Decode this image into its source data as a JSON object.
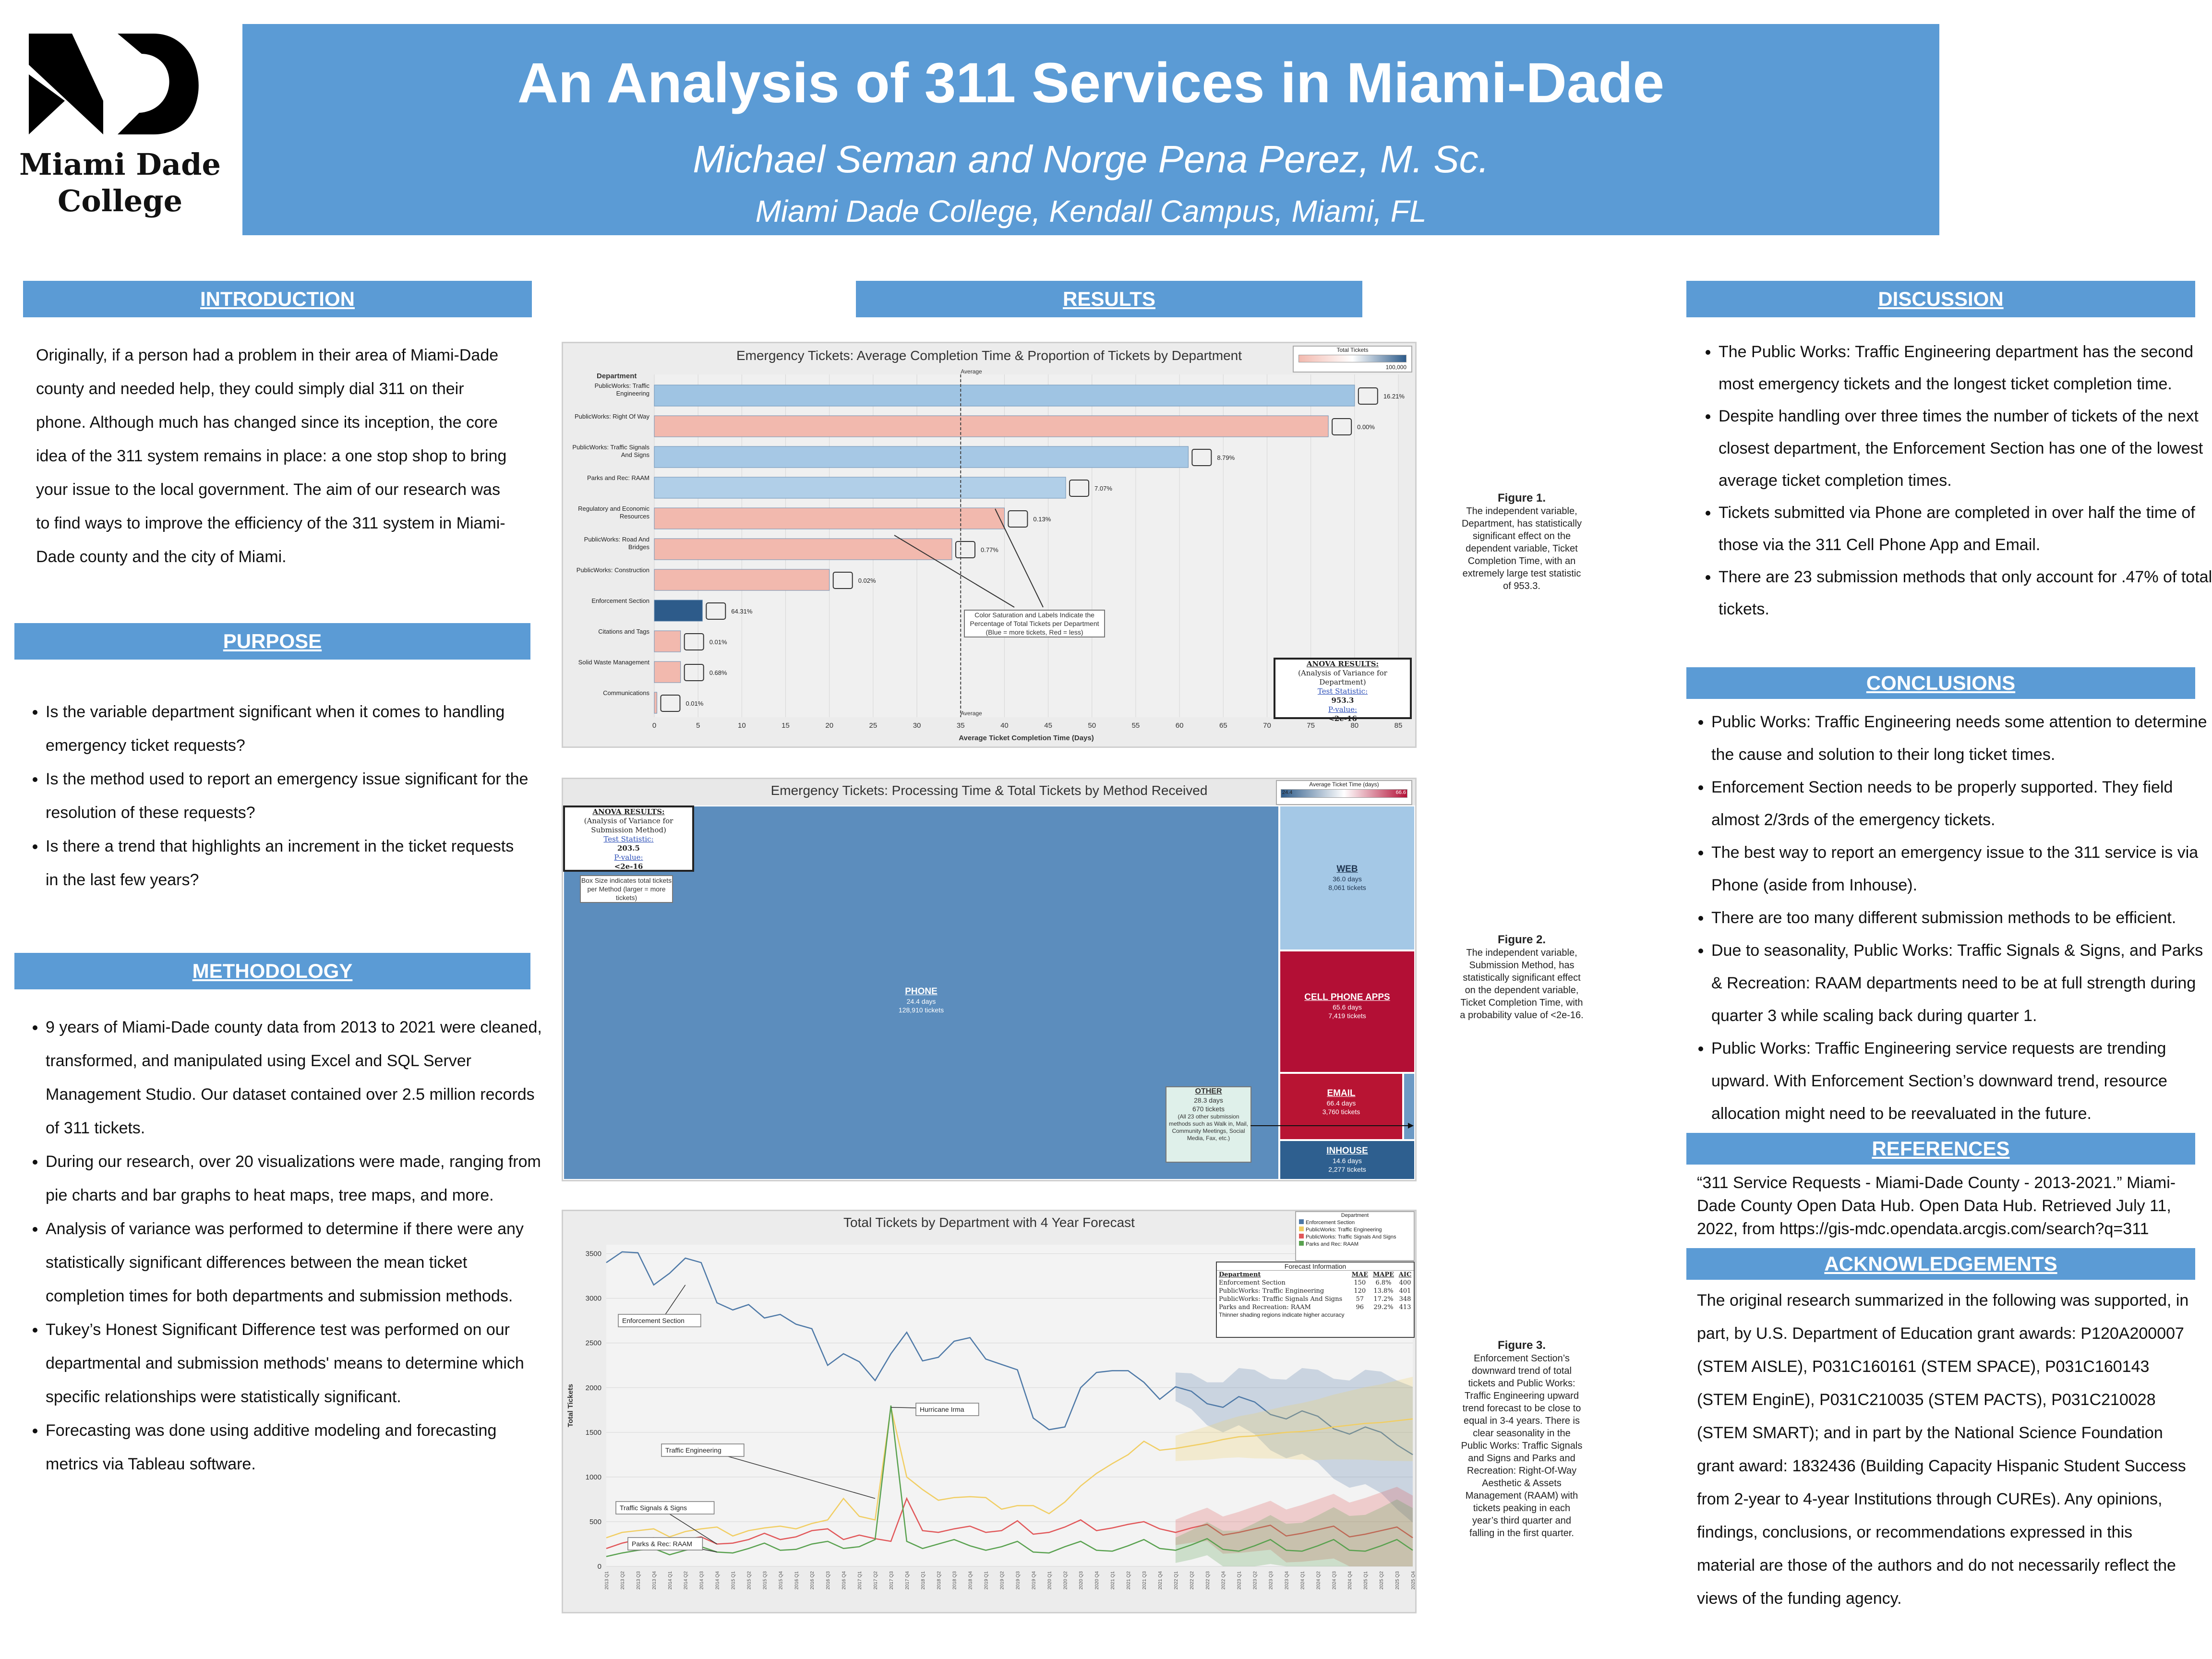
{
  "logo": {
    "line1": "Miami Dade",
    "line2": "College"
  },
  "title": "An Analysis of 311 Services in Miami-Dade",
  "authors": "Michael Seman and Norge Pena Perez, M. Sc.",
  "institution": "Miami Dade College, Kendall Campus, Miami, FL",
  "sections": {
    "introduction": {
      "heading": "INTRODUCTION",
      "text": "Originally, if a person had a problem in their area of Miami-Dade county and needed help, they could simply dial 311 on their phone.  Although much has changed since its inception, the core idea of the 311 system remains in place: a one stop shop to bring your issue to the local government.  The aim of our research was to find ways to improve the efficiency of the 311 system in Miami-Dade county and the city of Miami."
    },
    "purpose": {
      "heading": "PURPOSE",
      "items": [
        "Is the variable department significant when it comes to handling emergency ticket requests?",
        "Is the method used to report an emergency issue significant for the resolution of these requests?",
        "Is there a trend that highlights an increment in the ticket requests in the last few years?"
      ]
    },
    "methodology": {
      "heading": "METHODOLOGY",
      "items": [
        "9 years of Miami-Dade county data from 2013 to 2021 were cleaned, transformed, and manipulated using Excel and SQL Server Management Studio.  Our dataset contained over 2.5 million records of 311 tickets.",
        "During our research, over 20 visualizations were made, ranging from pie charts and bar graphs to heat maps, tree maps, and more.",
        "Analysis of variance was performed to determine if there were any statistically significant differences between the mean ticket completion times for both departments and submission methods.",
        "Tukey’s Honest Significant Difference test was performed on our departmental and submission methods' means to determine which specific relationships were statistically significant.",
        "Forecasting was done using additive modeling and forecasting metrics via Tableau software."
      ]
    },
    "results": {
      "heading": "RESULTS"
    },
    "discussion": {
      "heading": "DISCUSSION",
      "items": [
        "The Public Works: Traffic Engineering department has the second most emergency tickets and the longest ticket completion time.",
        "Despite handling over three times the number of tickets of the next closest department, the Enforcement Section has one of the lowest average ticket completion times.",
        "Tickets submitted via Phone are completed in over half the time of those via the 311 Cell Phone App and Email.",
        "There are 23 submission methods that only account for .47% of total tickets."
      ]
    },
    "conclusions": {
      "heading": "CONCLUSIONS",
      "items": [
        "Public Works: Traffic Engineering needs some attention to determine the cause and solution to their long ticket times.",
        "Enforcement Section needs to be properly supported. They field almost 2/3rds of the emergency tickets.",
        "The best way to report an emergency issue to the 311 service is via Phone (aside from Inhouse).",
        "There are too many different submission methods to be efficient.",
        "Due to seasonality, Public Works: Traffic Signals & Signs, and Parks & Recreation: RAAM departments need to be at full strength during quarter 3 while scaling back during quarter 1.",
        "Public Works: Traffic Engineering service requests are trending upward. With Enforcement Section’s downward trend, resource allocation might need to be reevaluated in the future."
      ]
    },
    "references": {
      "heading": "REFERENCES",
      "text": "“311 Service Requests - Miami-Dade County - 2013-2021.” Miami-Dade County Open Data Hub. Open Data Hub. Retrieved July 11, 2022, from https://gis-mdc.opendata.arcgis.com/search?q=311"
    },
    "acknowledgements": {
      "heading": "ACKNOWLEDGEMENTS",
      "text": "The original research summarized in the following was supported, in part, by U.S. Department of Education grant awards: P120A200007 (STEM AISLE), P031C160161 (STEM SPACE), P031C160143 (STEM EnginE), P031C210035 (STEM PACTS), P031C210028 (STEM SMART); and in part by the National Science Foundation grant award: 1832436 (Building Capacity Hispanic Student Success from 2-year to 4-year Institutions through CUREs). Any opinions, findings, conclusions, or recommendations expressed in this material are those of the authors and do not necessarily reflect the views of the funding agency."
    }
  },
  "figures": {
    "fig1": {
      "caption_label": "Figure 1.",
      "caption": "The independent variable, Department, has statistically significant effect on the dependent variable, Ticket Completion Time, with an extremely large test statistic of 953.3.",
      "note": "Color Saturation and Labels Indicate the Percentage of Total Tickets per Department (Blue = more tickets, Red = less)",
      "anova": {
        "h1": "ANOVA RESULTS:",
        "h2": "(Analysis of Variance for Department)",
        "l1": "Test Statistic:",
        "v1": "953.3",
        "l2": "P-value:",
        "v2": "<2e-16"
      },
      "legend_title": "Total Tickets",
      "legend_max": "100,000",
      "avg_label": "Average"
    },
    "fig2": {
      "title": "Emergency Tickets: Processing Time & Total Tickets by Method Received",
      "caption_label": "Figure 2.",
      "caption": "The independent variable, Submission Method, has statistically significant effect on the dependent variable, Ticket Completion Time, with a probability value of <2e-16.",
      "legend_title": "Average Ticket Time (days)",
      "legend_min": "24.4",
      "legend_max": "66.6",
      "anova": {
        "h1": "ANOVA RESULTS:",
        "h2": "(Analysis of Variance for Submission Method)",
        "l1": "Test Statistic:",
        "v1": "203.5",
        "l2": "P-value:",
        "v2": "<2e-16"
      },
      "note": "Box Size indicates total tickets per Method (larger = more tickets)",
      "boxes": {
        "phone": {
          "name": "PHONE",
          "days": "24.4 days",
          "tickets": "128,910 tickets"
        },
        "web": {
          "name": "WEB",
          "days": "36.0 days",
          "tickets": "8,061 tickets"
        },
        "cell": {
          "name": "CELL PHONE APPS",
          "days": "65.6 days",
          "tickets": "7,419 tickets"
        },
        "email": {
          "name": "EMAIL",
          "days": "66.4 days",
          "tickets": "3,760 tickets"
        },
        "inhouse": {
          "name": "INHOUSE",
          "days": "14.6 days",
          "tickets": "2,277 tickets"
        },
        "other": {
          "name": "OTHER",
          "days": "28.3 days",
          "tickets": "670 tickets",
          "desc": "(All 23 other submission methods such as Walk in, Mail, Community Meetings, Social Media, Fax, etc.)"
        }
      }
    },
    "fig3": {
      "caption_label": "Figure 3.",
      "caption": "Enforcement Section’s downward trend of total tickets and Public Works: Traffic Engineering upward trend forecast to be close to equal in 3-4 years.  There is clear seasonality in the Public Works: Traffic Signals and Signs and Parks and Recreation: Right-Of-Way Aesthetic & Assets Management (RAAM) with tickets peaking in each year’s third quarter and falling in the first quarter.",
      "forecast": {
        "title": "Forecast Information",
        "headers": [
          "Department",
          "MAE",
          "MAPE",
          "AIC"
        ],
        "rows": [
          [
            "Enforcement Section",
            "150",
            "6.8%",
            "400"
          ],
          [
            "PublicWorks: Traffic Engineering",
            "120",
            "13.8%",
            "401"
          ],
          [
            "PublicWorks: Traffic Signals And Signs",
            "57",
            "17.2%",
            "348"
          ],
          [
            "Parks and Recreation: RAAM",
            "96",
            "29.2%",
            "413"
          ]
        ],
        "note": "Thinner shading regions indicate higher accuracy"
      },
      "annotations": {
        "enf": "Enforcement Section",
        "te": "Traffic Engineering",
        "tss": "Traffic Signals & Signs",
        "raam": "Parks & Rec: RAAM",
        "irma": "Hurricane Irma"
      }
    }
  },
  "chart_data": [
    {
      "type": "bar",
      "title": "Emergency Tickets: Average Completion Time & Proportion of Tickets by Department",
      "xlabel": "Average Ticket Completion Time (Days)",
      "ylabel": "Department",
      "xlim": [
        0,
        85
      ],
      "xticks": [
        0,
        5,
        10,
        15,
        20,
        25,
        30,
        35,
        40,
        45,
        50,
        55,
        60,
        65,
        70,
        75,
        80,
        85
      ],
      "average": 35,
      "categories": [
        "PublicWorks: Traffic Engineering",
        "PublicWorks: Right Of Way",
        "PublicWorks: Traffic Signals And Signs",
        "Parks and Rec: RAAM",
        "Regulatory and Economic Resources",
        "PublicWorks: Road And Bridges",
        "PublicWorks: Construction",
        "Enforcement Section",
        "Citations and Tags",
        "Solid Waste Management",
        "Communications"
      ],
      "values": [
        80,
        77,
        61,
        47,
        40,
        34,
        20,
        5.5,
        3,
        3,
        0.3
      ],
      "pct_labels": [
        "16.21%",
        "0.00%",
        "8.79%",
        "7.07%",
        "0.13%",
        "0.77%",
        "0.02%",
        "64.31%",
        "0.01%",
        "0.68%",
        "0.01%"
      ],
      "colors": [
        "#9fc4e3",
        "#f2b9ae",
        "#a6c8e5",
        "#b1cfe8",
        "#f2b9ae",
        "#f2b9ae",
        "#f2b9ae",
        "#2d5b8a",
        "#f2b9ae",
        "#f2b9ae",
        "#f2b9ae"
      ],
      "grid": true
    },
    {
      "type": "line",
      "title": "Total Tickets by Department with 4 Year Forecast",
      "ylabel": "Total Tickets",
      "ylim": [
        0,
        3600
      ],
      "yticks": [
        0,
        500,
        1000,
        1500,
        2000,
        2500,
        3000,
        3500
      ],
      "x": [
        "2013 Q1",
        "2013 Q2",
        "2013 Q3",
        "2013 Q4",
        "2014 Q1",
        "2014 Q2",
        "2014 Q3",
        "2014 Q4",
        "2015 Q1",
        "2015 Q2",
        "2015 Q3",
        "2015 Q4",
        "2016 Q1",
        "2016 Q2",
        "2016 Q3",
        "2016 Q4",
        "2017 Q1",
        "2017 Q2",
        "2017 Q3",
        "2017 Q4",
        "2018 Q1",
        "2018 Q2",
        "2018 Q3",
        "2018 Q4",
        "2019 Q1",
        "2019 Q2",
        "2019 Q3",
        "2019 Q4",
        "2020 Q1",
        "2020 Q2",
        "2020 Q3",
        "2020 Q4",
        "2021 Q1",
        "2021 Q2",
        "2021 Q3",
        "2021 Q4",
        "2022 Q1",
        "2022 Q2",
        "2022 Q3",
        "2022 Q4",
        "2023 Q1",
        "2023 Q2",
        "2023 Q3",
        "2023 Q4",
        "2024 Q1",
        "2024 Q2",
        "2024 Q3",
        "2024 Q4",
        "2025 Q1",
        "2025 Q2",
        "2025 Q3",
        "2025 Q4"
      ],
      "forecast_start": 36,
      "legend_title": "Department",
      "legend_position": "top-right",
      "series": [
        {
          "name": "Enforcement Section",
          "color": "#4e79a7",
          "values": [
            3400,
            3520,
            3510,
            3150,
            3280,
            3450,
            3400,
            2950,
            2870,
            2930,
            2780,
            2820,
            2710,
            2660,
            2250,
            2380,
            2290,
            2080,
            2380,
            2620,
            2300,
            2340,
            2520,
            2560,
            2320,
            2260,
            2200,
            1660,
            1530,
            1560,
            2000,
            2170,
            2190,
            2190,
            2060,
            1870,
            2010,
            1960,
            1820,
            1780,
            1900,
            1840,
            1700,
            1650,
            1740,
            1680,
            1540,
            1480,
            1560,
            1500,
            1360,
            1250
          ]
        },
        {
          "name": "PublicWorks: Traffic Engineering",
          "color": "#f1ce63",
          "values": [
            320,
            380,
            400,
            420,
            330,
            390,
            420,
            440,
            340,
            400,
            430,
            450,
            420,
            480,
            520,
            760,
            560,
            520,
            1780,
            1000,
            860,
            740,
            770,
            780,
            770,
            640,
            680,
            680,
            590,
            720,
            900,
            1040,
            1150,
            1250,
            1400,
            1300,
            1320,
            1350,
            1380,
            1420,
            1450,
            1460,
            1480,
            1500,
            1510,
            1530,
            1560,
            1580,
            1600,
            1610,
            1630,
            1650
          ]
        },
        {
          "name": "PublicWorks: Traffic Signals And Signs",
          "color": "#e15759",
          "values": [
            200,
            260,
            300,
            320,
            230,
            300,
            330,
            250,
            260,
            300,
            370,
            300,
            330,
            400,
            420,
            300,
            350,
            310,
            280,
            760,
            400,
            380,
            420,
            450,
            380,
            400,
            510,
            360,
            380,
            440,
            520,
            400,
            430,
            470,
            500,
            420,
            380,
            430,
            470,
            350,
            380,
            420,
            460,
            340,
            370,
            410,
            450,
            330,
            360,
            400,
            440,
            320
          ]
        },
        {
          "name": "Parks and Rec: RAAM",
          "color": "#59a14f",
          "values": [
            110,
            150,
            180,
            200,
            130,
            180,
            220,
            160,
            150,
            200,
            260,
            180,
            190,
            250,
            280,
            200,
            220,
            300,
            1800,
            280,
            200,
            250,
            300,
            230,
            180,
            220,
            280,
            160,
            150,
            220,
            280,
            180,
            170,
            230,
            300,
            200,
            180,
            240,
            310,
            190,
            170,
            230,
            300,
            180,
            170,
            230,
            300,
            180,
            170,
            230,
            300,
            180
          ]
        }
      ]
    }
  ]
}
